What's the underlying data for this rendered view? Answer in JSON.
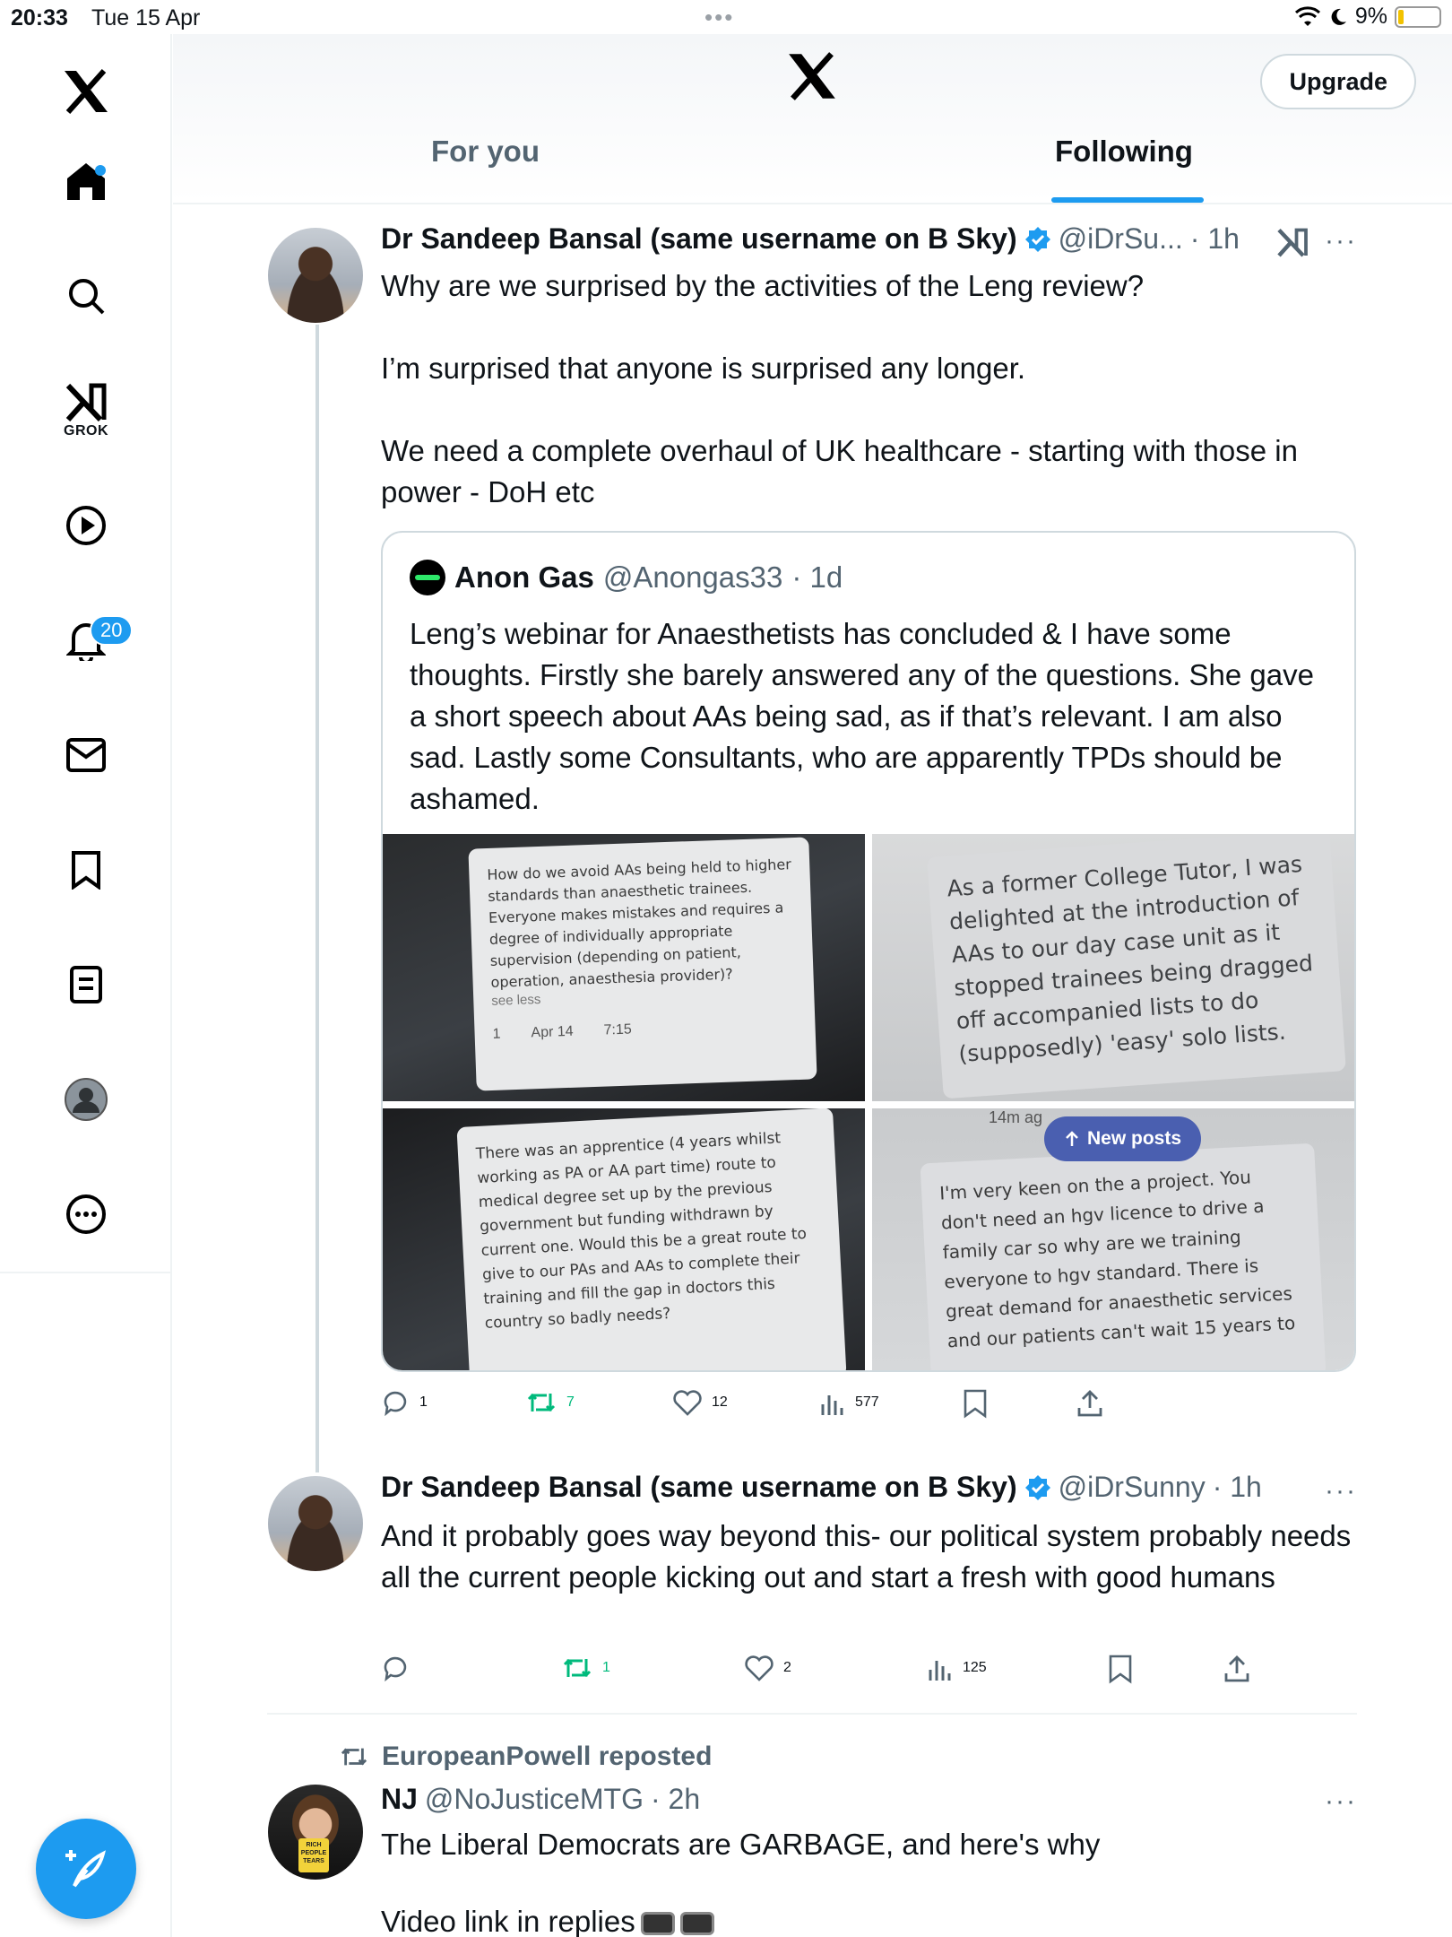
{
  "status_bar": {
    "time": "20:33",
    "date": "Tue 15 Apr",
    "battery": "9%"
  },
  "sidebar": {
    "grok_label": "GROK",
    "notifications_badge": "20"
  },
  "header": {
    "upgrade_label": "Upgrade",
    "tabs": [
      {
        "label": "For you",
        "active": false
      },
      {
        "label": "Following",
        "active": true
      }
    ]
  },
  "posts": [
    {
      "name": "Dr Sandeep Bansal (same username on B Sky)",
      "handle": "@iDrSu...",
      "time": "· 1h",
      "paragraphs": [
        "Why are we surprised by the activities of the Leng review?",
        "I’m surprised that anyone is surprised any longer.",
        "We need a complete overhaul of UK healthcare - starting with those in power - DoH etc"
      ],
      "quote": {
        "name": "Anon Gas",
        "handle": "@Anongas33",
        "time": "· 1d",
        "text": "Leng’s webinar for Anaesthetists has concluded & I have some thoughts. Firstly she barely answered any of the questions. She gave a short speech about AAs being sad, as if that’s relevant. I am also sad. Lastly some Consultants, who are apparently TPDs should be ashamed.",
        "photos": [
          {
            "text": "How do we avoid AAs being held to higher standards than anaesthetic trainees. Everyone makes mistakes and requires a degree of individually appropriate supervision (depending on patient, operation, anaesthesia provider)?",
            "see_less": "see less",
            "badge": "1",
            "date": "Apr 14",
            "clock": "7:15"
          },
          {
            "text": "As a former College Tutor, I was delighted at the introduction of AAs to our day case unit as it stopped trainees being dragged off accompanied lists to do (supposedly) 'easy' solo lists."
          },
          {
            "text": "There was an apprentice (4 years whilst working as PA or AA part time) route to medical degree set up by the previous government but funding withdrawn by current one. Would this be a great route to give to our PAs and AAs to complete their training and fill the gap in doctors this country so badly needs?"
          },
          {
            "time": "14m ag",
            "text": "I'm very keen on the a project. You don't need an hgv licence to drive a family car so why are we training everyone to hgv standard. There is great demand for anaesthetic services and our patients can't wait 15 years to"
          }
        ]
      },
      "stats": {
        "replies": "1",
        "reposts": "7",
        "likes": "12",
        "views": "577"
      }
    },
    {
      "name": "Dr Sandeep Bansal (same username on B Sky)",
      "handle": "@iDrSunny",
      "time": "· 1h",
      "text": "And it probably goes way beyond this- our political system probably needs all the current people kicking out and start a fresh with good humans",
      "stats": {
        "replies": "",
        "reposts": "1",
        "likes": "2",
        "views": "125"
      }
    },
    {
      "repost_label": "EuropeanPowell reposted",
      "name": "NJ",
      "handle": "@NoJusticeMTG",
      "time": "· 2h",
      "avatar_mug_text": "RICH PEOPLE TEARS",
      "paragraphs": [
        "The Liberal Democrats are GARBAGE, and here's why",
        "Video link in replies"
      ]
    }
  ],
  "new_posts_label": "New posts",
  "colors": {
    "accent": "#1d9bf0",
    "repost_green": "#00ba7c",
    "muted": "#536471"
  },
  "icons": [
    "x-logo-icon",
    "home-icon",
    "search-icon",
    "grok-icon",
    "play-icon",
    "bell-icon",
    "mail-icon",
    "bookmark-icon",
    "list-icon",
    "profile-icon",
    "more-circle-icon",
    "compose-icon",
    "verified-icon",
    "reply-icon",
    "repost-icon",
    "like-icon",
    "views-icon",
    "share-icon"
  ]
}
